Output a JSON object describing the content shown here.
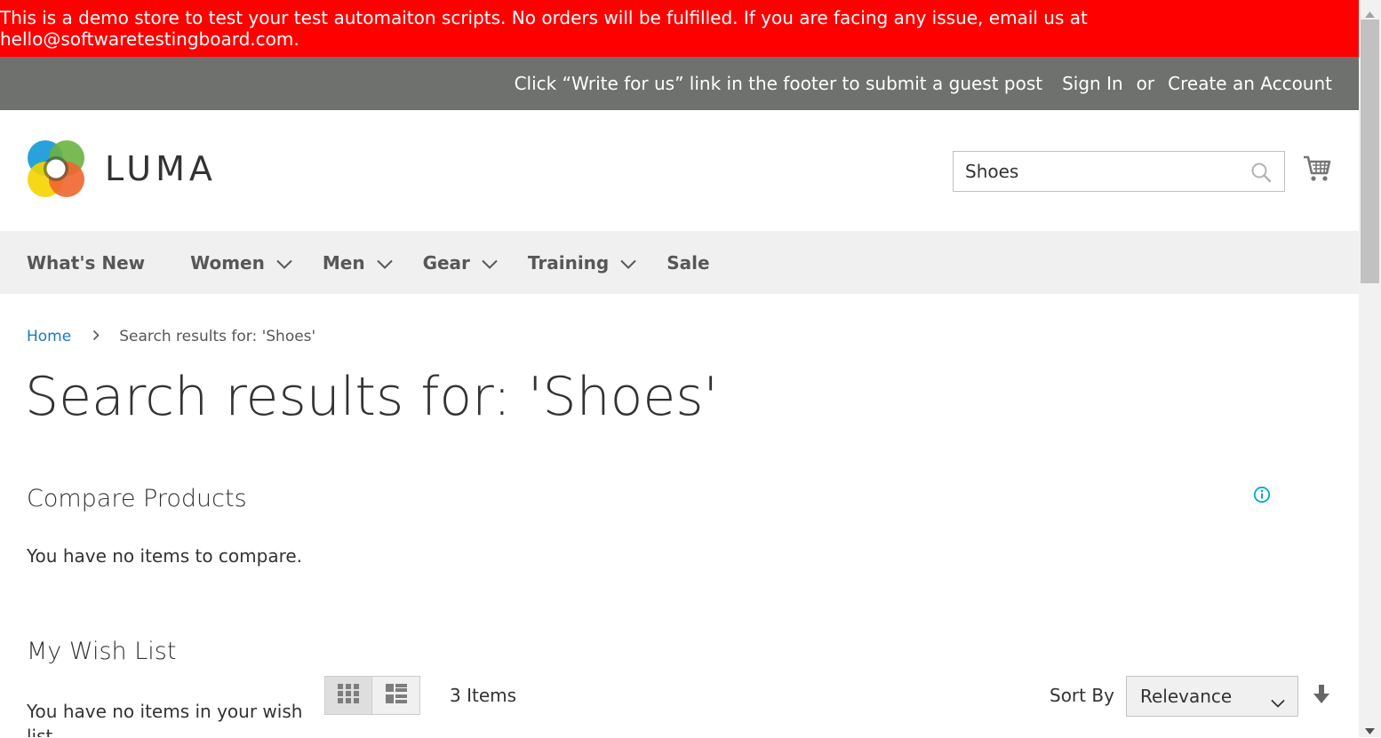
{
  "notice": {
    "text": "This is a demo store to test your test automaiton scripts. No orders will be fulfilled. If you are facing any issue, email us at hello@softwaretestingboard.com."
  },
  "header_panel": {
    "promo": "Click “Write for us” link in the footer to submit a guest post",
    "sign_in": "Sign In",
    "or": "or",
    "create_account": "Create an Account"
  },
  "logo": {
    "text": "LUMA"
  },
  "search": {
    "value": "Shoes"
  },
  "nav": {
    "items": [
      {
        "label": "What's New",
        "has_dropdown": false
      },
      {
        "label": "Women",
        "has_dropdown": true
      },
      {
        "label": "Men",
        "has_dropdown": true
      },
      {
        "label": "Gear",
        "has_dropdown": true
      },
      {
        "label": "Training",
        "has_dropdown": true
      },
      {
        "label": "Sale",
        "has_dropdown": false
      }
    ]
  },
  "breadcrumbs": {
    "home": "Home",
    "current": "Search results for: 'Shoes'"
  },
  "page_title": "Search results for: 'Shoes'",
  "compare": {
    "title": "Compare Products",
    "empty": "You have no items to compare."
  },
  "wishlist": {
    "title": "My Wish List",
    "empty": "You have no items in your wish list."
  },
  "toolbar": {
    "items_count": "3 Items",
    "sort_label": "Sort By",
    "sort_value": "Relevance"
  },
  "colors": {
    "notice_bg": "#ff0000",
    "header_panel_bg": "#6e716e",
    "nav_bg": "#f0f0f0",
    "link": "#1979c3",
    "info": "#00aacc"
  }
}
